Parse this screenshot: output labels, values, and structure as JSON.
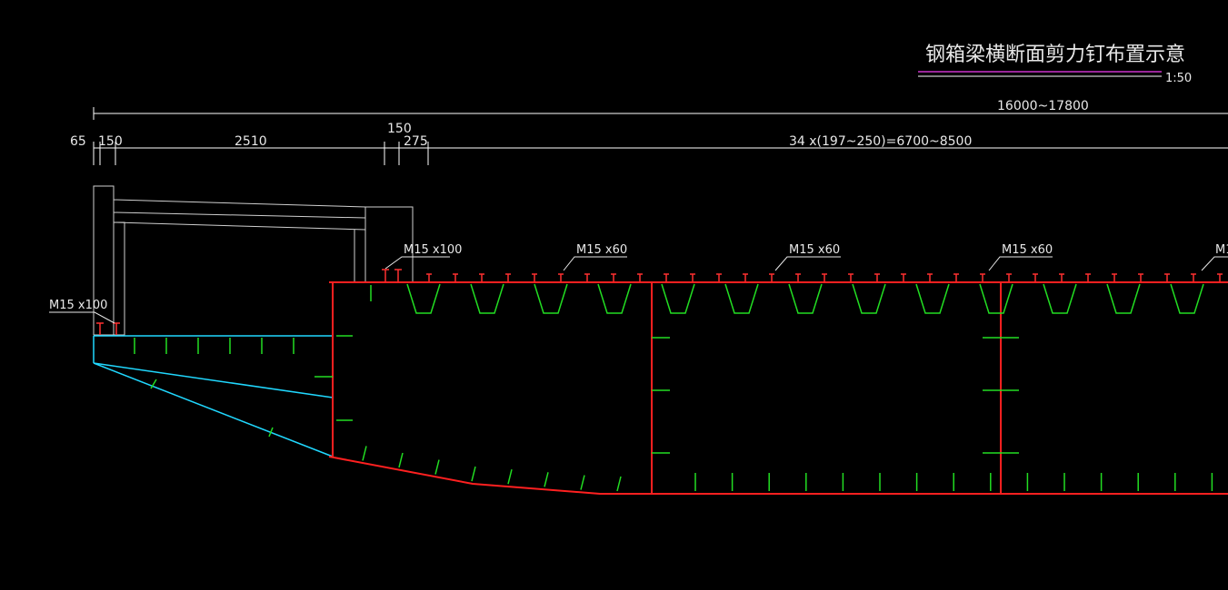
{
  "title": "钢箱梁横断面剪力钉布置示意",
  "scale": "1:50",
  "dimensions": {
    "overall": "16000~17800",
    "d65": "65",
    "d150a": "150",
    "d2510": "2510",
    "d150b": "150",
    "d275": "275",
    "stud_spacing": "34 x(197~250)=6700~8500"
  },
  "stud_labels": {
    "cantilever": "M15 x100",
    "top_left": "M15 x100",
    "top_a": "M15 x60",
    "top_b": "M15 x60",
    "top_c": "M15 x60",
    "top_d_partial": "M1"
  },
  "colors": {
    "girder": "#ff2020",
    "stiffener": "#22dd22",
    "cantilever": "#20d8ff",
    "concrete": "#cfcfcf",
    "dimension": "#ffffff",
    "title_underline": "#cc33cc"
  }
}
